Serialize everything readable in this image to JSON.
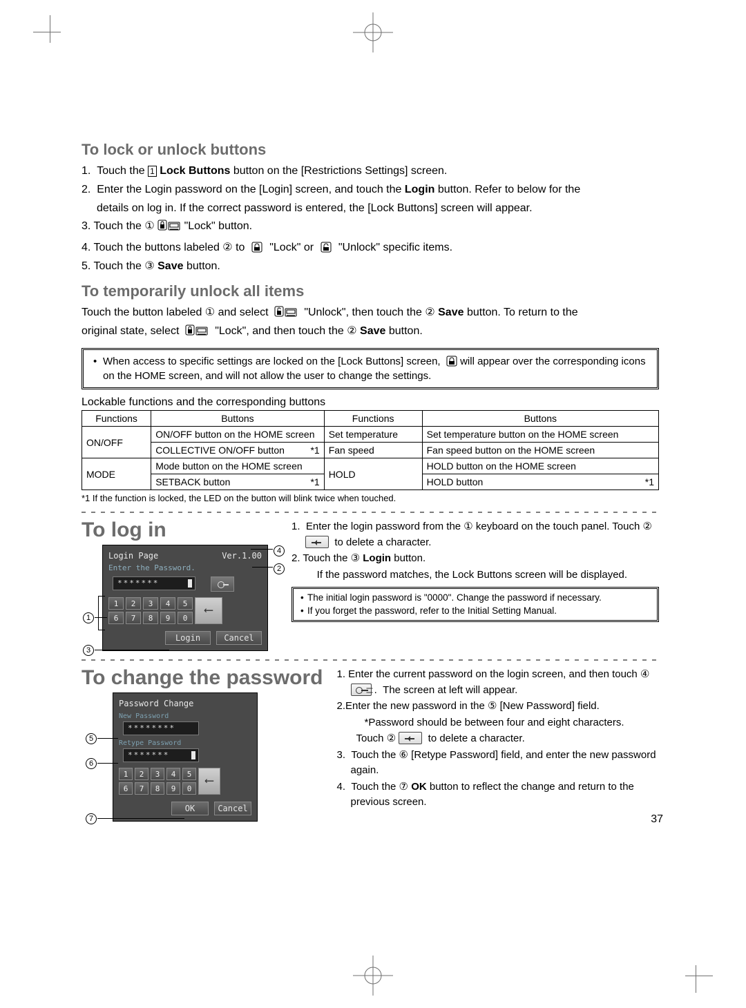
{
  "page_number": "37",
  "sections": {
    "lock": {
      "heading": "To lock or unlock buttons",
      "steps": [
        "1.  Touch the ①  Lock Buttons  button on the [Restrictions Settings] screen.",
        "2.  Enter the Login password on the [Login] screen, and touch the  Login  button. Refer to below for the details on log in. If the correct password is entered, the [Lock Buttons] screen will appear.",
        "3. Touch the ①  [LOCK]  \"Lock\" button.",
        "4. Touch the buttons labeled ② to  [L]  \"Lock\" or  [U]  \"Unlock\" specific items.",
        "5. Touch the ③  Save  button."
      ]
    },
    "temp": {
      "heading": "To temporarily unlock all items",
      "body1": "Touch the button labeled ① and select  [U]  \"Unlock\", then touch the ②  Save  button. To return to the original state, select  [L]  \"Lock\", and then touch the ②  Save  button."
    },
    "info1": "When access to specific settings are locked on the [Lock Buttons] screen,  [L]  will appear over the corresponding icons on the HOME screen, and will not allow the user to change the settings.",
    "table": {
      "caption": "Lockable functions and the corresponding buttons",
      "headers": [
        "Functions",
        "Buttons",
        "Functions",
        "Buttons"
      ],
      "rows": [
        [
          "ON/OFF",
          "ON/OFF button on the HOME screen",
          "Set temperature",
          "Set temperature button on the HOME screen"
        ],
        [
          "",
          "COLLECTIVE ON/OFF button *1",
          "Fan speed",
          "Fan speed button on the HOME screen"
        ],
        [
          "MODE",
          "Mode button on the HOME screen",
          "HOLD",
          "HOLD button on the HOME screen"
        ],
        [
          "",
          "SETBACK button *1",
          "",
          "HOLD button *1"
        ]
      ],
      "footnote": "*1 If the function is locked, the LED on the button will blink twice when touched."
    },
    "login": {
      "heading": "To log in",
      "steps": [
        "1.  Enter the login password from the ① keyboard on the touch panel. Touch ②  [BS]  to delete a character.",
        "2. Touch the ③  Login  button.",
        "    If the password matches, the Lock Buttons screen will be displayed."
      ],
      "info": [
        "The initial login password is \"0000\". Change the password if necessary.",
        "If you forget the password, refer to the Initial Setting Manual."
      ],
      "panel": {
        "title": "Login Page",
        "ver": "Ver.1.00",
        "hint": "Enter the Password.",
        "pw": "*******",
        "ok": "Login",
        "cancel": "Cancel"
      }
    },
    "change": {
      "heading": "To change the password",
      "steps": [
        "1. Enter the current password on the login screen, and then touch ④  [KEY]  .  The screen at left will appear.",
        "2.Enter the new password in the ⑤ [New Password] field.",
        "       *Password should be between four and eight characters.",
        "     Touch ②  [BS]  to delete a character.",
        "3.  Touch the ⑥ [Retype Password] field, and enter the new password again.",
        "4.  Touch the ⑦  OK  button to reflect  the  change  and  return  to the previous screen."
      ],
      "panel": {
        "title": "Password Change",
        "new": "New Password",
        "newv": "********",
        "retype": "Retype Password",
        "retypev": "*******",
        "ok": "OK",
        "cancel": "Cancel"
      }
    }
  },
  "keypad": [
    "1",
    "2",
    "3",
    "4",
    "5",
    "6",
    "7",
    "8",
    "9",
    "0"
  ]
}
